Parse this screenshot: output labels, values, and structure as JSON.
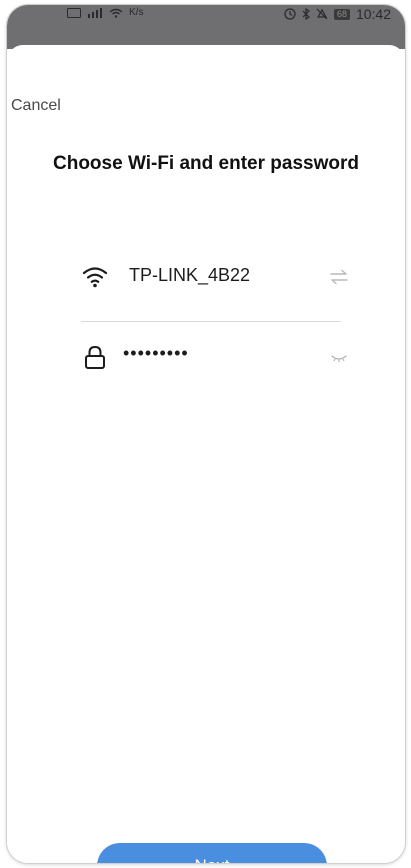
{
  "status_bar": {
    "left_text": "K/s",
    "time": "10:42",
    "battery": "68"
  },
  "header": {
    "cancel_label": "Cancel",
    "title": "Choose Wi-Fi and enter password"
  },
  "wifi": {
    "icon": "wifi-icon",
    "ssid": "TP-LINK_4B22",
    "switch_icon": "swap-icon"
  },
  "password": {
    "icon": "lock-icon",
    "value": "•••••••••",
    "visibility_icon": "eye-closed-icon"
  },
  "footer": {
    "next_label": "Next"
  },
  "colors": {
    "accent": "#4a8fdf",
    "status_bar": "#6f6f71"
  }
}
